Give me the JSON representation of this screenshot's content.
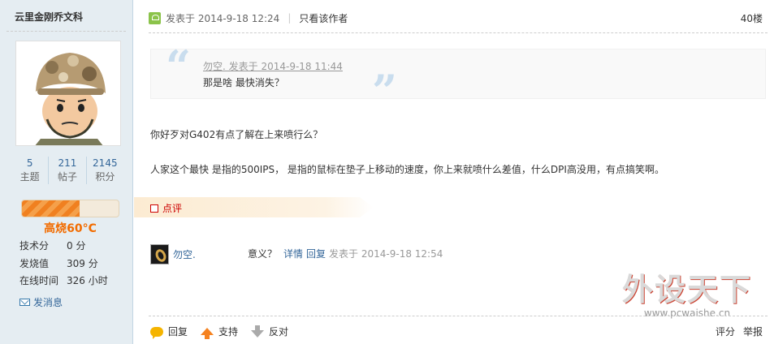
{
  "author": {
    "name": "云里金刚乔文科",
    "stats": [
      {
        "value": "5",
        "label": "主题"
      },
      {
        "value": "211",
        "label": "帖子"
      },
      {
        "value": "2145",
        "label": "积分"
      }
    ],
    "heat_level": 0.6,
    "heat_title": "高烧60°C",
    "info": [
      {
        "key": "技术分",
        "value": "0 分"
      },
      {
        "key": "发烧值",
        "value": "309 分"
      },
      {
        "key": "在线时间",
        "value": "326 小时"
      }
    ],
    "send_message": "发消息"
  },
  "post": {
    "posted_at": "发表于 2014-9-18 12:24",
    "author_only": "只看该作者",
    "floor": "40楼",
    "quote": {
      "meta": "勿空. 发表于 2014-9-18 11:44",
      "text": "那是啥 最快消失？"
    },
    "lines": [
      "你好歹对G402有点了解在上来喷行么？",
      "人家这个最快 是指的500IPS， 是指的鼠标在垫子上移动的速度，你上来就喷什么差值，什么DPI高没用，有点搞笑啊。"
    ],
    "comment_label": "点评",
    "comment": {
      "user": "勿空.",
      "text": "意义？",
      "detail_link": "详情",
      "reply_link": "回复",
      "time": "发表于 2014-9-18 12:54"
    },
    "actions": {
      "reply": "回复",
      "support": "支持",
      "oppose": "反对",
      "rate": "评分",
      "report": "举报"
    }
  },
  "watermark": {
    "text": "外设天下",
    "url": "www.pcwaishe.cn"
  }
}
